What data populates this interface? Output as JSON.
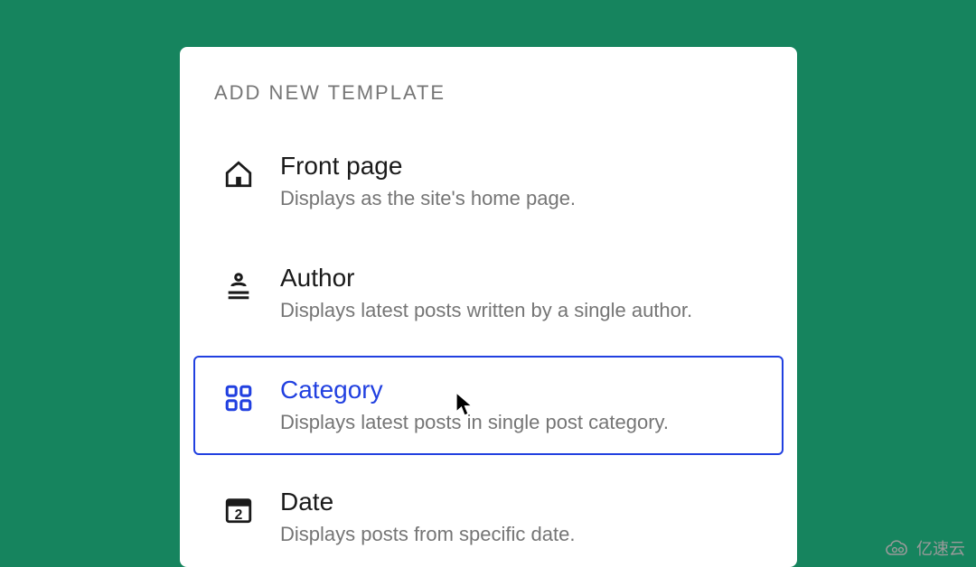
{
  "panel": {
    "heading": "ADD NEW TEMPLATE",
    "items": [
      {
        "icon": "home-icon",
        "title": "Front page",
        "desc": "Displays as the site's home page.",
        "selected": false
      },
      {
        "icon": "author-icon",
        "title": "Author",
        "desc": "Displays latest posts written by a single author.",
        "selected": false
      },
      {
        "icon": "category-icon",
        "title": "Category",
        "desc": "Displays latest posts in single post category.",
        "selected": true
      },
      {
        "icon": "date-icon",
        "title": "Date",
        "desc": "Displays posts from specific date.",
        "selected": false
      }
    ]
  },
  "date_icon_number": "2",
  "watermark": {
    "text": "亿速云"
  },
  "colors": {
    "background": "#16845e",
    "panel_bg": "#ffffff",
    "heading": "#767676",
    "title": "#1a1a1a",
    "desc": "#757575",
    "accent": "#2140e0"
  }
}
